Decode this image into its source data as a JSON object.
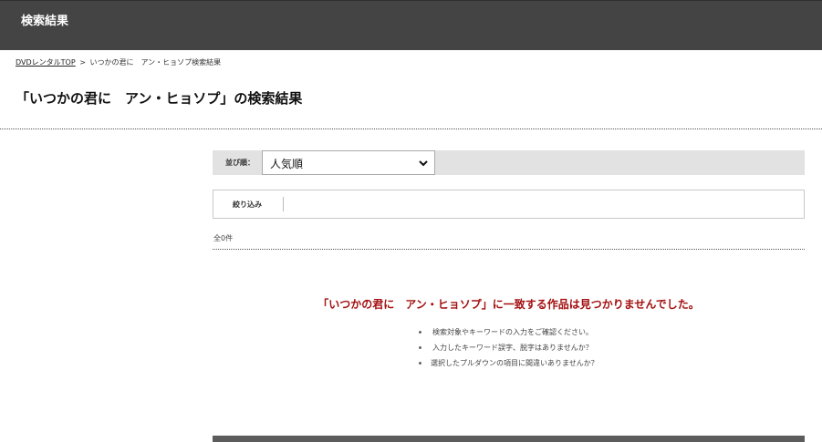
{
  "header": {
    "title": "検索結果"
  },
  "breadcrumb": {
    "home_link": "DVDレンタルTOP",
    "separator": ">",
    "current": "いつかの君に　アン・ヒョソプ検索結果"
  },
  "page_title": "「いつかの君に　アン・ヒョソプ」の検索結果",
  "sort": {
    "label": "並び順：",
    "selected": "人気順",
    "icon": "chevron-down-icon"
  },
  "filter": {
    "label": "絞り込み"
  },
  "result_count": "全0件",
  "no_result": {
    "message": "「いつかの君に　アン・ヒョソプ」に一致する作品は見つかりませんでした。",
    "hints": [
      "検索対象やキーワードの入力をご確認ください。",
      "入力したキーワード誤字、脱字はありませんか？",
      "選択したプルダウンの項目に間違いありませんか？"
    ]
  },
  "colors": {
    "header_bg": "#444444",
    "sort_bar_bg": "#e2e2e2",
    "no_result_text": "#a31010",
    "bottom_bar": "#5c5c5c"
  }
}
